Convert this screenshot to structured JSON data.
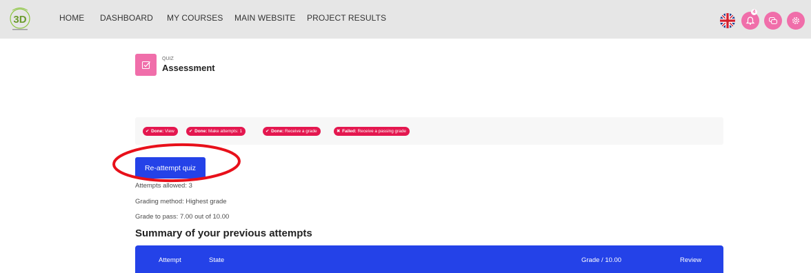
{
  "navbar": {
    "logo_text": "3D",
    "items": [
      "HOME",
      "DASHBOARD",
      "MY COURSES",
      "MAIN WEBSITE",
      "PROJECT RESULTS"
    ],
    "notification_count": "4",
    "icons": [
      "uk-flag-icon",
      "bell-icon",
      "chat-icon",
      "gear-icon"
    ],
    "accent_color": "#f06eaa"
  },
  "activity": {
    "type": "QUIZ",
    "title": "Assessment"
  },
  "completion": {
    "items": [
      {
        "status": "Done:",
        "text": "View",
        "mark": "✔"
      },
      {
        "status": "Done:",
        "text": "Make attempts: 1",
        "mark": "✔"
      },
      {
        "status": "Done:",
        "text": "Receive a grade",
        "mark": "✔"
      },
      {
        "status": "Failed:",
        "text": "Receive a passing grade",
        "mark": "✖"
      }
    ],
    "color": "#e4174f"
  },
  "quiz": {
    "button_label": "Re-attempt quiz",
    "attempts_allowed": "Attempts allowed: 3",
    "grading_method": "Grading method: Highest grade",
    "grade_to_pass": "Grade to pass: 7.00 out of 10.00",
    "button_color": "#2442e8"
  },
  "summary": {
    "title": "Summary of your previous attempts",
    "columns": [
      "Attempt",
      "State",
      "Grade / 10.00",
      "Review"
    ]
  },
  "annotation": {
    "color": "#e8101a"
  }
}
